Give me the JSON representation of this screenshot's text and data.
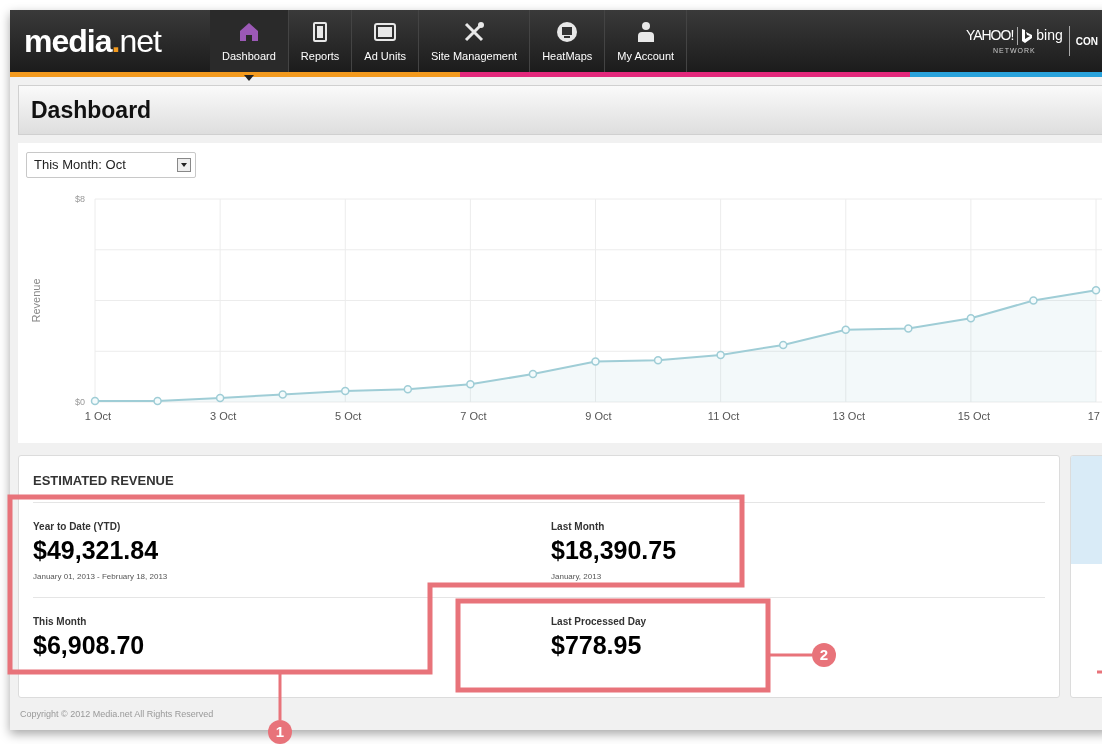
{
  "header": {
    "logo_main": "media",
    "logo_dot": ".",
    "logo_tail": "net",
    "nav": [
      {
        "label": "Dashboard",
        "selected": true
      },
      {
        "label": "Reports",
        "selected": false
      },
      {
        "label": "Ad Units",
        "selected": false
      },
      {
        "label": "Site Management",
        "selected": false
      },
      {
        "label": "HeatMaps",
        "selected": false
      },
      {
        "label": "My Account",
        "selected": false
      }
    ],
    "partner": {
      "yahoo": "YAHOO!",
      "bing": "bing",
      "network": "NETWORK",
      "cut": "CON"
    }
  },
  "page_title": "Dashboard",
  "period_select": {
    "value": "This Month: Oct"
  },
  "chart": {
    "chart_data": {
      "type": "area",
      "grid": true,
      "ylabel": "Revenue",
      "categories": [
        "1 Oct",
        null,
        "3 Oct",
        null,
        "5 Oct",
        null,
        "7 Oct",
        null,
        "9 Oct",
        null,
        "11 Oct",
        null,
        "13 Oct",
        null,
        "15 Oct",
        null,
        "17"
      ],
      "series": [
        {
          "color": "#9fcdd6",
          "values": [
            0.04,
            0.04,
            0.16,
            0.3,
            0.43,
            0.5,
            0.7,
            1.1,
            1.6,
            1.65,
            1.85,
            2.25,
            2.85,
            2.9,
            3.3,
            4.0,
            4.4
          ]
        }
      ],
      "ylim": [
        0,
        8
      ],
      "yticks": [
        {
          "value": 0,
          "label": "$0"
        },
        {
          "value": 8,
          "label": "$8"
        }
      ]
    }
  },
  "estimated_revenue": {
    "title": "ESTIMATED REVENUE",
    "stats": [
      {
        "label": "Year to Date (YTD)",
        "value": "$49,321.84",
        "note": "January 01, 2013 - February 18, 2013"
      },
      {
        "label": "Last Month",
        "value": "$18,390.75",
        "note": "January, 2013"
      },
      {
        "label": "This Month",
        "value": "$6,908.70"
      },
      {
        "label": "Last Processed Day",
        "value": "$778.95"
      }
    ]
  },
  "callouts": [
    "1",
    "2"
  ],
  "footer": "Copyright © 2012 Media.net All Rights Reserved"
}
